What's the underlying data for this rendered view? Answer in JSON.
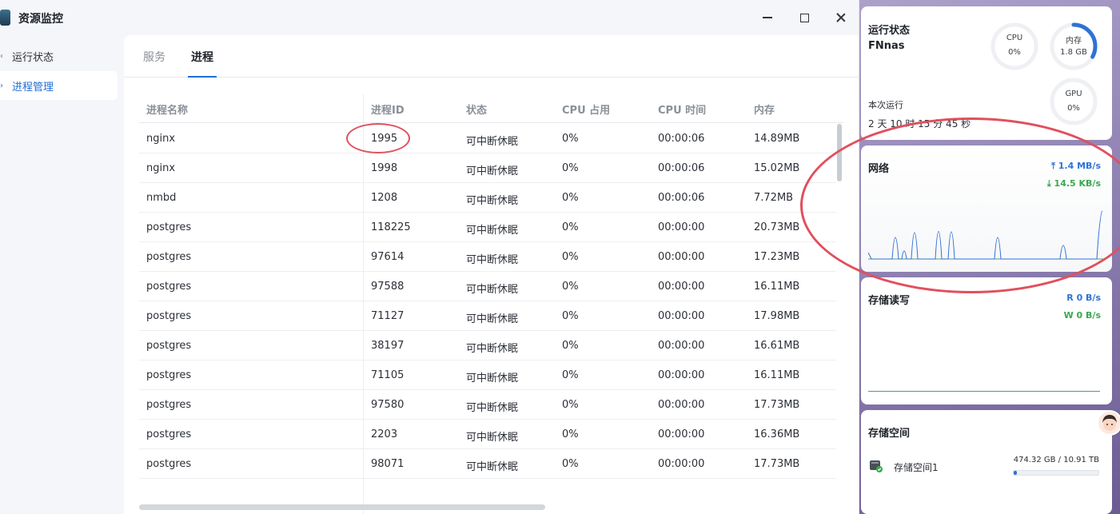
{
  "window": {
    "title": "资源监控"
  },
  "sidebar": {
    "items": [
      {
        "label": "运行状态",
        "active": false
      },
      {
        "label": "进程管理",
        "active": true
      }
    ]
  },
  "tabs": [
    {
      "label": "服务",
      "active": false
    },
    {
      "label": "进程",
      "active": true
    }
  ],
  "process_table": {
    "columns": [
      "进程名称",
      "进程ID",
      "状态",
      "CPU 占用",
      "CPU 时间",
      "内存"
    ],
    "rows": [
      [
        "nginx",
        "1995",
        "可中断休眠",
        "0%",
        "00:00:06",
        "14.89MB"
      ],
      [
        "nginx",
        "1998",
        "可中断休眠",
        "0%",
        "00:00:06",
        "15.02MB"
      ],
      [
        "nmbd",
        "1208",
        "可中断休眠",
        "0%",
        "00:00:06",
        "7.72MB"
      ],
      [
        "postgres",
        "118225",
        "可中断休眠",
        "0%",
        "00:00:00",
        "20.73MB"
      ],
      [
        "postgres",
        "97614",
        "可中断休眠",
        "0%",
        "00:00:00",
        "17.23MB"
      ],
      [
        "postgres",
        "97588",
        "可中断休眠",
        "0%",
        "00:00:00",
        "16.11MB"
      ],
      [
        "postgres",
        "71127",
        "可中断休眠",
        "0%",
        "00:00:00",
        "17.98MB"
      ],
      [
        "postgres",
        "38197",
        "可中断休眠",
        "0%",
        "00:00:00",
        "16.61MB"
      ],
      [
        "postgres",
        "71105",
        "可中断休眠",
        "0%",
        "00:00:00",
        "16.11MB"
      ],
      [
        "postgres",
        "97580",
        "可中断休眠",
        "0%",
        "00:00:00",
        "17.73MB"
      ],
      [
        "postgres",
        "2203",
        "可中断休眠",
        "0%",
        "00:00:00",
        "16.36MB"
      ],
      [
        "postgres",
        "98071",
        "可中断休眠",
        "0%",
        "00:00:00",
        "17.73MB"
      ]
    ]
  },
  "widgets": {
    "status": {
      "title": "运行状态",
      "hostname": "FNnas",
      "uptime_label": "本次运行",
      "uptime": "2 天 10 时 15 分 45 秒",
      "cpu": {
        "label": "CPU",
        "value": "0%"
      },
      "memory": {
        "label": "内存",
        "value": "1.8 GB",
        "fraction": 0.33
      },
      "gpu": {
        "label": "GPU",
        "value": "0%"
      }
    },
    "network": {
      "title": "网络",
      "upload": "1.4 MB/s",
      "download": "14.5 KB/s"
    },
    "disk_io": {
      "title": "存储读写",
      "read": "R  0 B/s",
      "write": "W  0 B/s"
    },
    "storage": {
      "title": "存储空间",
      "volume_name": "存储空间1",
      "usage": "474.32 GB / 10.91 TB",
      "fraction": 0.04
    }
  },
  "colors": {
    "accent": "#1e6fd9",
    "upload": "#2f72d6",
    "download": "#3aa84f",
    "annotation": "#e0505d"
  }
}
